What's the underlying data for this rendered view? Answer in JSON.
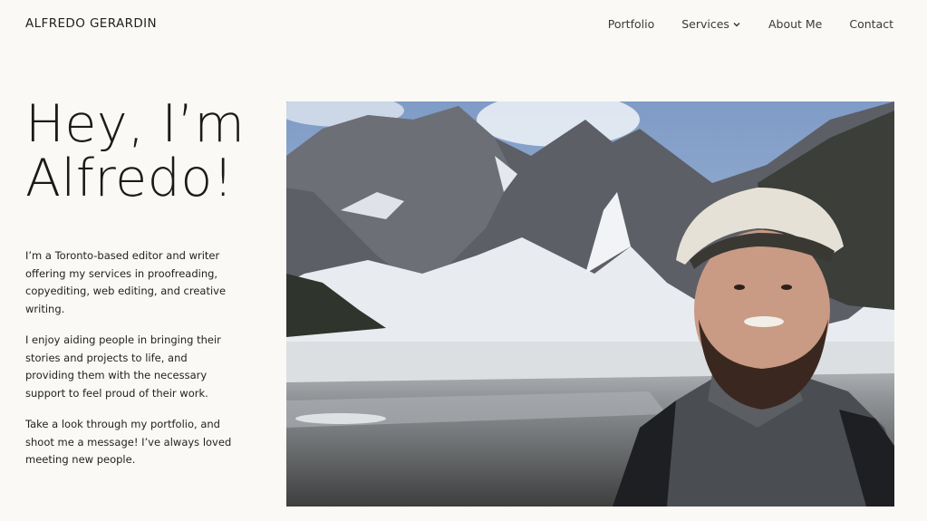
{
  "site": {
    "title": "ALFREDO GERARDIN"
  },
  "nav": {
    "items": [
      {
        "label": "Portfolio"
      },
      {
        "label": "Services"
      },
      {
        "label": "About Me"
      },
      {
        "label": "Contact"
      }
    ]
  },
  "hero": {
    "headline_line1": "Hey, I’m",
    "headline_line2": "Alfredo!",
    "paragraphs": [
      "I’m a Toronto-based editor and writer offering my services in proofreading, copyediting, web editing, and creative writing.",
      "I enjoy aiding people in bringing their stories and projects to life, and providing them with the necessary support to feel proud of their work.",
      "Take a look through my portfolio, and shoot me a message! I’ve always loved meeting new people."
    ]
  },
  "icons": {
    "services_dropdown": "chevron-down-icon"
  },
  "colors": {
    "background": "#faf9f5",
    "text": "#1d1d1d"
  }
}
